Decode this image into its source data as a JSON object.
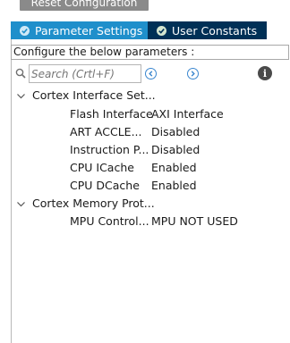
{
  "toolbar": {
    "reset_label": "Reset Configuration"
  },
  "tabs": [
    {
      "label": "Parameter Settings",
      "active": true
    },
    {
      "label": "User Constants",
      "active": false
    }
  ],
  "configure_label": "Configure the below parameters :",
  "search": {
    "placeholder": "Search (Crtl+F)"
  },
  "tree": {
    "groups": [
      {
        "label": "Cortex Interface Set...",
        "params": [
          {
            "name": "Flash Interface",
            "value": "AXI Interface"
          },
          {
            "name": "ART ACCLE...",
            "value": "Disabled"
          },
          {
            "name": "Instruction P...",
            "value": "Disabled"
          },
          {
            "name": "CPU ICache",
            "value": "Enabled"
          },
          {
            "name": "CPU DCache",
            "value": "Enabled"
          }
        ]
      },
      {
        "label": "Cortex Memory Prot...",
        "params": [
          {
            "name": "MPU Control...",
            "value": "MPU NOT USED"
          }
        ]
      }
    ]
  },
  "colors": {
    "tab_active": "#1f8fcb",
    "tab_inactive": "#003056",
    "reset_button": "#8a8a8a",
    "nav_icon": "#3a86cf"
  },
  "icons": [
    "search-icon",
    "check-circle-icon",
    "prev-arrow-icon",
    "next-arrow-icon",
    "info-icon",
    "chevron-down-icon"
  ]
}
